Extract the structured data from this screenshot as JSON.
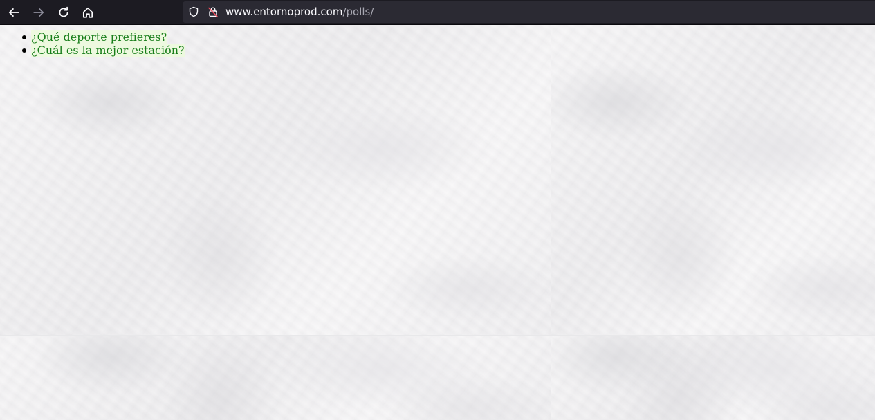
{
  "browser": {
    "url_domain": "www.entornoprod.com",
    "url_path": "/polls/",
    "icons": {
      "back": "arrow-left-icon",
      "forward": "arrow-right-icon",
      "reload": "reload-icon",
      "home": "home-icon",
      "tracking_protection": "shield-icon",
      "security": "lock-warning-icon"
    }
  },
  "polls": {
    "questions": [
      {
        "text": "¿Qué deporte prefieres?"
      },
      {
        "text": "¿Cuál es la mejor estación?"
      }
    ]
  },
  "colors": {
    "link": "#187e1a",
    "toolbar_bg": "#1c1b22",
    "urlbar_bg": "#2b2a33",
    "page_bg": "#f2f1f2"
  }
}
